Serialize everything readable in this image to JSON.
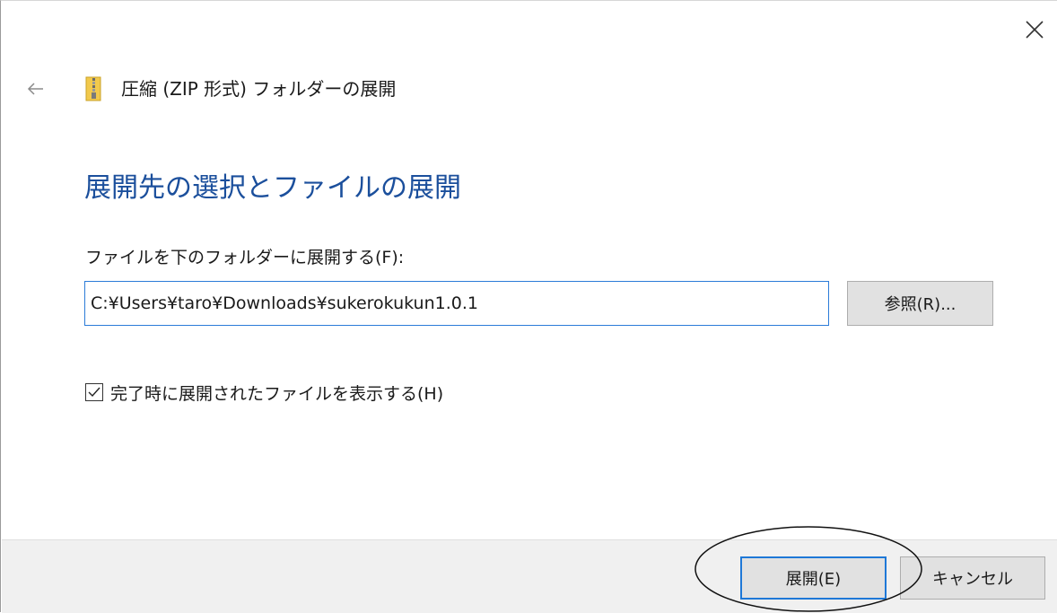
{
  "window": {
    "title": "圧縮 (ZIP 形式) フォルダーの展開",
    "back_icon": "arrow-left-icon",
    "close_icon": "close-icon",
    "folder_icon": "zip-folder-icon"
  },
  "main": {
    "heading": "展開先の選択とファイルの展開",
    "field_label": "ファイルを下のフォルダーに展開する(F):",
    "path_value": "C:¥Users¥taro¥Downloads¥sukerokukun1.0.1",
    "browse_label": "参照(R)...",
    "show_files_checkbox": {
      "label": "完了時に展開されたファイルを表示する(H)",
      "checked": true
    }
  },
  "footer": {
    "extract_label": "展開(E)",
    "cancel_label": "キャンセル"
  },
  "colors": {
    "heading": "#1b4f9c",
    "input_border": "#2b7bd8",
    "default_button_border": "#1e78d7",
    "footer_background": "#f0f0f0",
    "button_background": "#e1e1e1"
  }
}
